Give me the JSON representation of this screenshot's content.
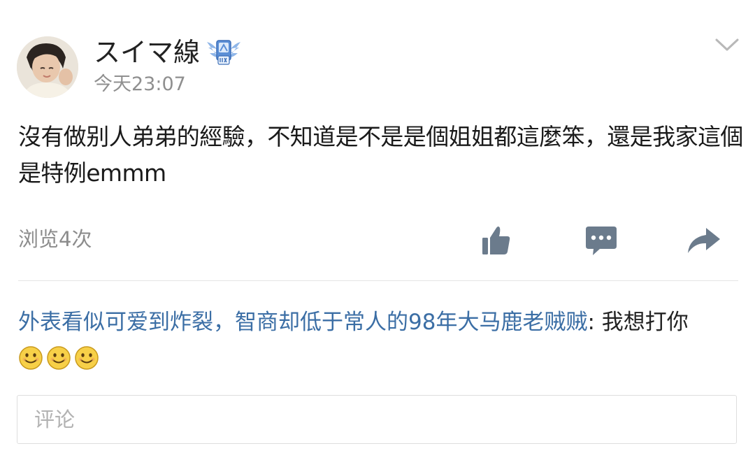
{
  "post": {
    "author": {
      "name": "スイマ線",
      "avatar_icon": "user-avatar-photo",
      "badge_icon": "winged-level-badge-icon"
    },
    "timestamp": "今天23:07",
    "text": "沒有做别人弟弟的經驗，不知道是不是是個姐姐都這麼笨，還是我家這個是特例emmm",
    "views": "浏览4次"
  },
  "actions": {
    "like_icon": "thumbs-up-icon",
    "comment_icon": "comment-bubble-icon",
    "share_icon": "share-arrow-icon",
    "dropdown_icon": "chevron-down-icon"
  },
  "comments": [
    {
      "author": "外表看似可爱到炸裂，智商却低于常人的98年大马鹿老贼贼",
      "separator": ": ",
      "text": "我想打你",
      "emojis": [
        "smile-emoji",
        "smile-emoji",
        "smile-emoji"
      ]
    }
  ],
  "comment_input": {
    "placeholder": "评论"
  },
  "colors": {
    "link": "#3b6ea5",
    "icon": "#6b7b8c",
    "muted": "#8f8f8f",
    "emoji": "#f7d048"
  }
}
